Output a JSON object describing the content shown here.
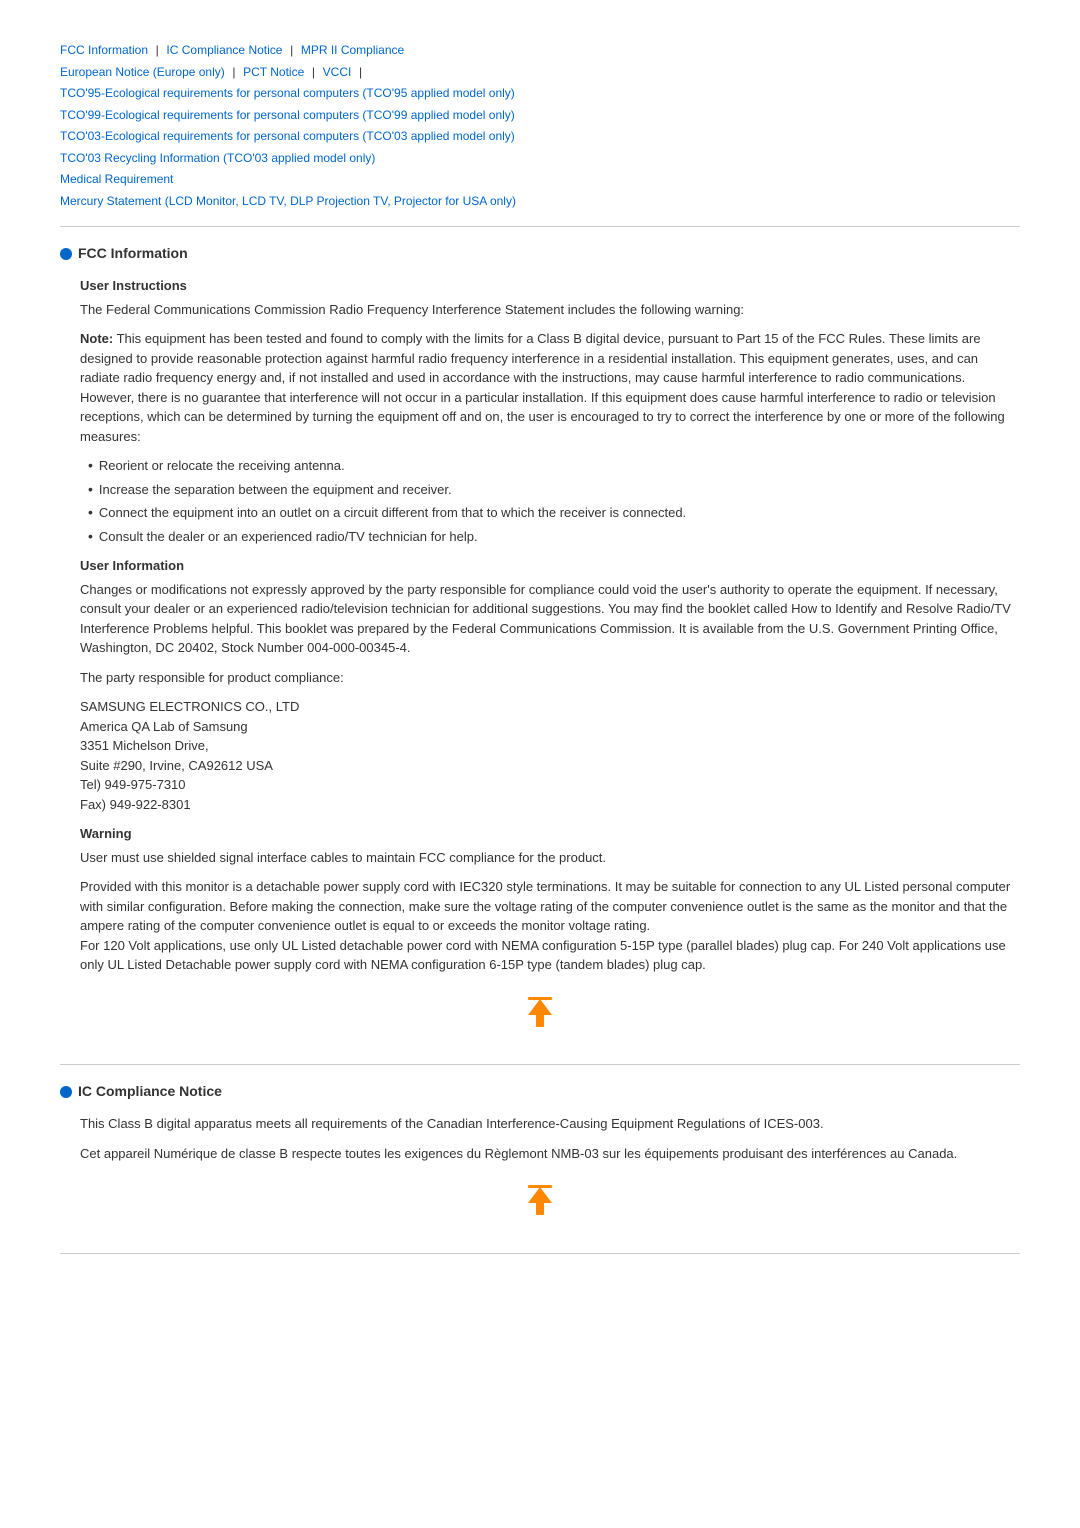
{
  "nav": {
    "line1": [
      {
        "text": "FCC Information",
        "sep": " | "
      },
      {
        "text": "IC Compliance Notice",
        "sep": " | "
      },
      {
        "text": "MPR II Compliance",
        "sep": ""
      }
    ],
    "line2": [
      {
        "text": "European Notice (Europe only)",
        "sep": " | "
      },
      {
        "text": "PCT Notice",
        "sep": " | "
      },
      {
        "text": "VCCI",
        "sep": " | "
      }
    ],
    "line3": {
      "text": "TCO'95-Ecological requirements for personal computers (TCO'95 applied model only)"
    },
    "line4": {
      "text": "TCO'99-Ecological requirements for personal computers (TCO'99 applied model only)"
    },
    "line5": {
      "text": "TCO'03-Ecological requirements for personal computers (TCO'03 applied model only)"
    },
    "line6": {
      "text": "TCO'03 Recycling Information (TCO'03 applied model only)"
    },
    "line7": {
      "text": "Medical Requirement"
    },
    "line8": {
      "text": "Mercury Statement (LCD Monitor, LCD TV, DLP Projection TV, Projector for USA only)"
    }
  },
  "fcc_section": {
    "title": "FCC Information",
    "user_instructions_title": "User Instructions",
    "user_instructions_p1": "The Federal Communications Commission Radio Frequency Interference Statement includes the following warning:",
    "user_instructions_note": "Note: This equipment has been tested and found to comply with the limits for a Class B digital device, pursuant to Part 15 of the FCC Rules. These limits are designed to provide reasonable protection against harmful radio frequency interference in a residential installation. This equipment generates, uses, and can radiate radio frequency energy and, if not installed and used in accordance with the instructions, may cause harmful interference to radio communications. However, there is no guarantee that interference will not occur in a particular installation. If this equipment does cause harmful interference to radio or television receptions, which can be determined by turning the equipment off and on, the user is encouraged to try to correct the interference by one or more of the following measures:",
    "bullets": [
      "Reorient or relocate the receiving antenna.",
      "Increase the separation between the equipment and receiver.",
      "Connect the equipment into an outlet on a circuit different from that to which the receiver is connected.",
      "Consult the dealer or an experienced radio/TV technician for help."
    ],
    "user_information_title": "User Information",
    "user_information_p1": "Changes or modifications not expressly approved by the party responsible for compliance could void the user's authority to operate the equipment. If necessary, consult your dealer or an experienced radio/television technician for additional suggestions. You may find the booklet called How to Identify and Resolve Radio/TV Interference Problems helpful. This booklet was prepared by the Federal Communications Commission. It is available from the U.S. Government Printing Office, Washington, DC 20402, Stock Number 004-000-00345-4.",
    "user_information_p2": "The party responsible for product compliance:",
    "address": "SAMSUNG ELECTRONICS CO., LTD\nAmerica QA Lab of Samsung\n3351 Michelson Drive,\nSuite #290, Irvine, CA92612 USA\nTel) 949-975-7310\nFax) 949-922-8301",
    "warning_title": "Warning",
    "warning_p1": "User must use shielded signal interface cables to maintain FCC compliance for the product.",
    "warning_p2": "Provided with this monitor is a detachable power supply cord with IEC320 style terminations. It may be suitable for connection to any UL Listed personal computer with similar configuration. Before making the connection, make sure the voltage rating of the computer convenience outlet is the same as the monitor and that the ampere rating of the computer convenience outlet is equal to or exceeds the monitor voltage rating.\nFor 120 Volt applications, use only UL Listed detachable power cord with NEMA configuration 5-15P type (parallel blades) plug cap. For 240 Volt applications use only UL Listed Detachable power supply cord with NEMA configuration 6-15P type (tandem blades) plug cap."
  },
  "ic_section": {
    "title": "IC Compliance Notice",
    "p1": "This Class B digital apparatus meets all requirements of the Canadian Interference-Causing Equipment Regulations of ICES-003.",
    "p2": "Cet appareil Numérique de classe B respecte toutes les exigences du Règlemont NMB-03 sur les équipements produisant des interférences au Canada."
  },
  "top_button_label": "Top"
}
